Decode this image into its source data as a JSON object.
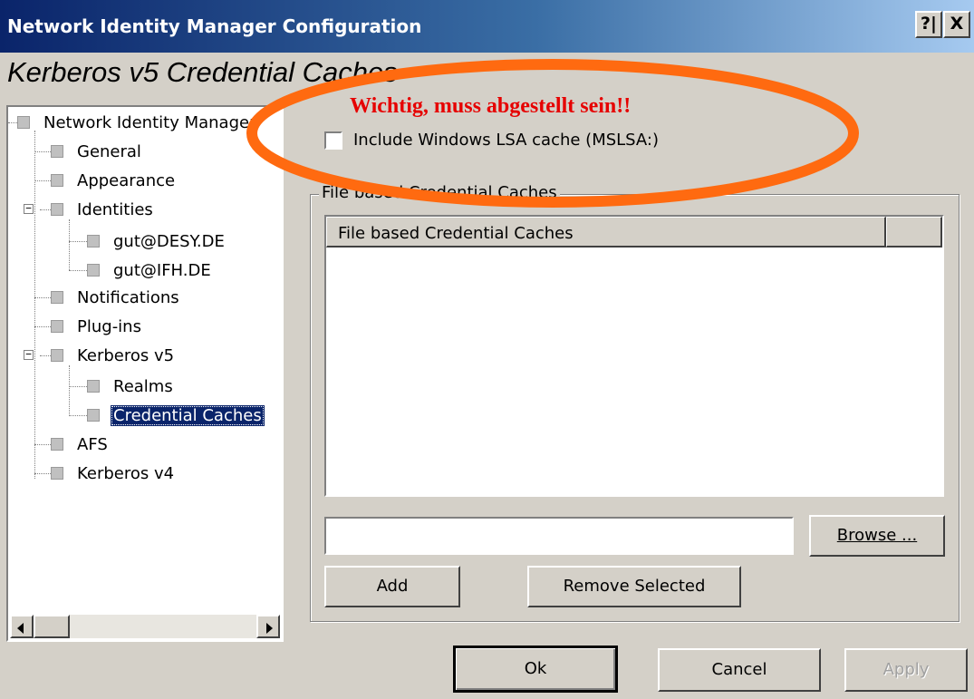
{
  "window": {
    "title": "Network Identity Manager Configuration",
    "help_button": "?|",
    "close_button": "X"
  },
  "page_title": "Kerberos v5 Credential Caches",
  "annotation": {
    "text": "Wichtig, muss abgestellt sein!!",
    "color": "#e60000",
    "ellipse_color": "#ff6a10"
  },
  "tree": {
    "items": [
      {
        "label": "Network Identity Manager"
      },
      {
        "label": "General"
      },
      {
        "label": "Appearance"
      },
      {
        "label": "Identities"
      },
      {
        "label": "gut@DESY.DE"
      },
      {
        "label": "gut@IFH.DE"
      },
      {
        "label": "Notifications"
      },
      {
        "label": "Plug-ins"
      },
      {
        "label": "Kerberos v5"
      },
      {
        "label": "Realms"
      },
      {
        "label": "Credential Caches",
        "selected": true
      },
      {
        "label": "AFS"
      },
      {
        "label": "Kerberos v4"
      }
    ],
    "selection_color": "#0a246a"
  },
  "options": {
    "include_lsa_label": "Include Windows LSA cache (MSLSA:)",
    "include_lsa_checked": false
  },
  "file_caches": {
    "group_label": "File based Credential Caches",
    "column_header": "File based Credential Caches",
    "rows": [],
    "input_value": "",
    "browse_label": "Browse ...",
    "add_label": "Add",
    "remove_label": "Remove Selected"
  },
  "footer": {
    "ok_label": "Ok",
    "cancel_label": "Cancel",
    "apply_label": "Apply",
    "apply_enabled": false
  }
}
